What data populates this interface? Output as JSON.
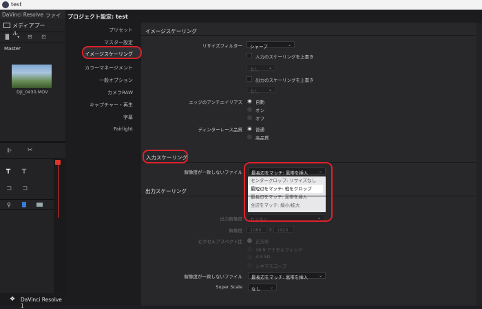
{
  "window": {
    "title": "test"
  },
  "menubar": {
    "app": "DaVinci Resolve",
    "file": "ファイル"
  },
  "toolbar": {
    "media_pool": "メディアプール"
  },
  "media": {
    "bin_label": "Master",
    "clip_name": "DJI_0430.MOV"
  },
  "footer": {
    "app_name": "DaVinci Resolve 1"
  },
  "dialog": {
    "title": "プロジェクト設定: test"
  },
  "nav": [
    {
      "label": "プリセット"
    },
    {
      "label": "マスター設定"
    },
    {
      "label": "イメージスケーリング"
    },
    {
      "label": "カラーマネージメント"
    },
    {
      "label": "一般オプション"
    },
    {
      "label": "カメラRAW"
    },
    {
      "label": "キャプチャー・再生"
    },
    {
      "label": "字幕"
    },
    {
      "label": "Fairlight"
    }
  ],
  "image_scaling": {
    "title": "イメージスケーリング",
    "resize_filter_label": "リサイズフィルター",
    "resize_filter_value": "シャープ",
    "override_input_label": "入力のスケーリングを上書き",
    "override_input_value": "なし",
    "override_output_label": "出力のスケーリングを上書き",
    "override_output_value": "なし",
    "antialias_label": "エッジのアンチエイリアス",
    "antialias_options": [
      "自動",
      "オン",
      "オフ"
    ],
    "deinterlace_label": "ディンターレース品質",
    "deinterlace_options": [
      "普通",
      "高品質"
    ]
  },
  "input_scaling": {
    "title": "入力スケーリング",
    "mismatch_label": "解像度が一致しないファイル",
    "mismatch_value": "最長辺をマッチ: 黒帯を挿入",
    "options": [
      "センタークロップ: リサイズなし",
      "最短辺をマッチ: 他をクロップ",
      "最長辺をマッチ: 黒帯を挿入",
      "全辺をマッチ: 縦小/拡大"
    ]
  },
  "output_scaling": {
    "title": "出力スケーリング",
    "format_label": "出力解像度",
    "format_value": "カスタム",
    "resolution_label": "解像度",
    "res_w": "1080",
    "res_x": "x",
    "res_h": "1920",
    "pixel_aspect_label": "ピクセルアスペクト比",
    "pixel_aspect_options": [
      "正方形",
      "16:9 アナモルフィック",
      "4:3 SD",
      "シネマスコープ"
    ],
    "mismatch_label": "解像度が一致しないファイル",
    "mismatch_value": "最長辺をマッチ: 黒帯を挿入",
    "superscale_label": "Super Scale",
    "superscale_value": "なし"
  }
}
